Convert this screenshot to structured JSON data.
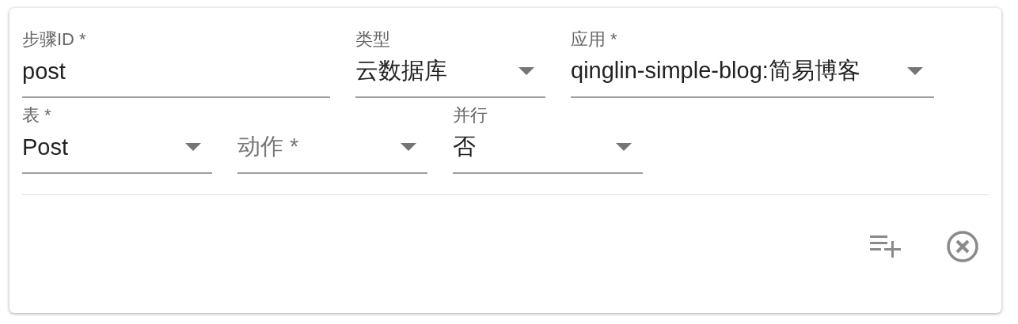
{
  "rows": [
    [
      {
        "kind": "text",
        "label": "步骤ID *",
        "value": "post"
      },
      {
        "kind": "select",
        "label": "类型",
        "value": "云数据库"
      },
      {
        "kind": "select",
        "label": "应用 *",
        "value": "qinglin-simple-blog:简易博客"
      }
    ],
    [
      {
        "kind": "select",
        "label": "表 *",
        "value": "Post"
      },
      {
        "kind": "select",
        "label": "动作 *"
      },
      {
        "kind": "select",
        "label": "并行",
        "value": "否"
      }
    ]
  ]
}
